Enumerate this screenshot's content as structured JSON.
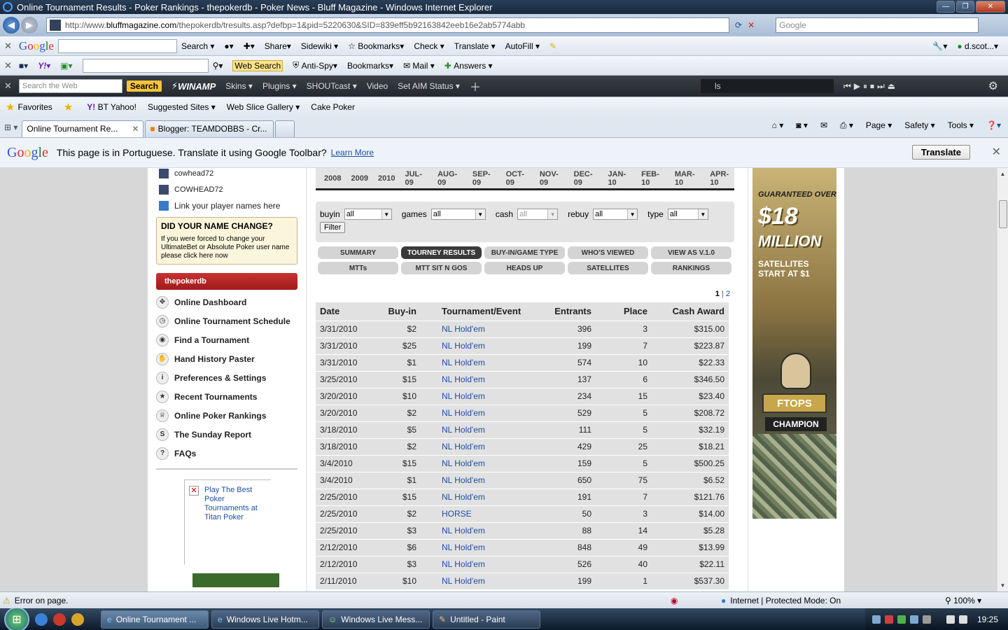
{
  "window": {
    "title": "Online Tournament Results - Poker Rankings - thepokerdb - Poker News - Bluff Magazine - Windows Internet Explorer"
  },
  "address": {
    "prefix": "http://www.",
    "domain": "bluffmagazine.com",
    "path": "/thepokerdb/tresults.asp?defbp=1&pid=5220630&SID=839eff5b92163842eeb16e2ab5774abb",
    "search_placeholder": "Google"
  },
  "google_toolbar": {
    "search": "Search",
    "share": "Share",
    "sidewiki": "Sidewiki",
    "bookmarks": "Bookmarks",
    "check": "Check",
    "translate": "Translate",
    "autofill": "AutoFill",
    "account": "d.scot..."
  },
  "yahoo_toolbar": {
    "web_search": "Web Search",
    "anti_spy": "Anti-Spy",
    "bookmarks": "Bookmarks",
    "mail": "Mail",
    "answers": "Answers"
  },
  "winamp_toolbar": {
    "placeholder": "Search the Web",
    "search": "Search",
    "brand": "WINAMP",
    "skins": "Skins",
    "plugins": "Plugins",
    "shoutcast": "SHOUTcast",
    "video": "Video",
    "aim": "Set AIM Status",
    "player_text": "ls"
  },
  "favorites": {
    "favorites": "Favorites",
    "bt_yahoo": "BT Yahoo!",
    "suggested": "Suggested Sites",
    "web_slice": "Web Slice Gallery",
    "cake": "Cake Poker"
  },
  "tabs": [
    {
      "label": "Online Tournament Re..."
    },
    {
      "label": "Blogger: TEAMDOBBS - Cr..."
    }
  ],
  "commands": {
    "page": "Page",
    "safety": "Safety",
    "tools": "Tools"
  },
  "translate_bar": {
    "logo": "Google",
    "message": "This page is in Portuguese.  Translate it using Google Toolbar?",
    "learn_more": "Learn More",
    "button": "Translate"
  },
  "sidebar": {
    "players": [
      "cowhead72",
      "COWHEAD72",
      "Link your player names here"
    ],
    "name_change": {
      "heading": "DID YOUR NAME CHANGE?",
      "text": "If you were forced to change your UltimateBet or Absolute Poker user name please click here now"
    },
    "header": "thepokerdb",
    "menu": [
      {
        "label": "Online Dashboard",
        "icon": "✥"
      },
      {
        "label": "Online Tournament Schedule",
        "icon": "◷"
      },
      {
        "label": "Find a Tournament",
        "icon": "◉"
      },
      {
        "label": "Hand History Paster",
        "icon": "✋"
      },
      {
        "label": "Preferences & Settings",
        "icon": "i"
      },
      {
        "label": "Recent Tournaments",
        "icon": "★"
      },
      {
        "label": "Online Poker Rankings",
        "icon": "♕"
      },
      {
        "label": "The Sunday Report",
        "icon": "S"
      },
      {
        "label": "FAQs",
        "icon": "?"
      }
    ],
    "ad_text": "Play The Best Poker Tournaments at Titan Poker"
  },
  "dates": [
    "2008",
    "2009",
    "2010",
    "JUL-09",
    "AUG-09",
    "SEP-09",
    "OCT-09",
    "NOV-09",
    "DEC-09",
    "JAN-10",
    "FEB-10",
    "MAR-10",
    "APR-10"
  ],
  "filters": {
    "buyin": {
      "label": "buyin",
      "value": "all"
    },
    "games": {
      "label": "games",
      "value": "all"
    },
    "cash": {
      "label": "cash",
      "value": "all"
    },
    "rebuy": {
      "label": "rebuy",
      "value": "all"
    },
    "type": {
      "label": "type",
      "value": "all"
    },
    "button": "Filter"
  },
  "view_tabs": [
    "SUMMARY",
    "TOURNEY RESULTS",
    "BUY-IN/GAME TYPE",
    "WHO'S VIEWED",
    "VIEW AS V.1.0",
    "MTTs",
    "MTT SIT N GOS",
    "HEADS UP",
    "SATELLITES",
    "RANKINGS"
  ],
  "pager": {
    "current": "1",
    "sep": "|",
    "next": "2"
  },
  "table": {
    "headers": [
      "Date",
      "Buy-in",
      "Tournament/Event",
      "Entrants",
      "Place",
      "Cash Award"
    ],
    "rows": [
      [
        "3/31/2010",
        "$2",
        "NL Hold'em",
        "396",
        "3",
        "$315.00"
      ],
      [
        "3/31/2010",
        "$25",
        "NL Hold'em",
        "199",
        "7",
        "$223.87"
      ],
      [
        "3/31/2010",
        "$1",
        "NL Hold'em",
        "574",
        "10",
        "$22.33"
      ],
      [
        "3/25/2010",
        "$15",
        "NL Hold'em",
        "137",
        "6",
        "$346.50"
      ],
      [
        "3/20/2010",
        "$10",
        "NL Hold'em",
        "234",
        "15",
        "$23.40"
      ],
      [
        "3/20/2010",
        "$2",
        "NL Hold'em",
        "529",
        "5",
        "$208.72"
      ],
      [
        "3/18/2010",
        "$5",
        "NL Hold'em",
        "111",
        "5",
        "$32.19"
      ],
      [
        "3/18/2010",
        "$2",
        "NL Hold'em",
        "429",
        "25",
        "$18.21"
      ],
      [
        "3/4/2010",
        "$15",
        "NL Hold'em",
        "159",
        "5",
        "$500.25"
      ],
      [
        "3/4/2010",
        "$1",
        "NL Hold'em",
        "650",
        "75",
        "$6.52"
      ],
      [
        "2/25/2010",
        "$15",
        "NL Hold'em",
        "191",
        "7",
        "$121.76"
      ],
      [
        "2/25/2010",
        "$2",
        "HORSE",
        "50",
        "3",
        "$14.00"
      ],
      [
        "2/25/2010",
        "$3",
        "NL Hold'em",
        "88",
        "14",
        "$5.28"
      ],
      [
        "2/12/2010",
        "$6",
        "NL Hold'em",
        "848",
        "49",
        "$13.99"
      ],
      [
        "2/12/2010",
        "$3",
        "NL Hold'em",
        "526",
        "40",
        "$22.11"
      ],
      [
        "2/11/2010",
        "$10",
        "NL Hold'em",
        "199",
        "1",
        "$537.30"
      ]
    ]
  },
  "ad": {
    "line1": "GUARANTEED OVER",
    "amount": "$18",
    "million": "MILLION",
    "line3": "SATELLITES START AT $1",
    "ftops": "FTOPS",
    "champion": "CHAMPION"
  },
  "status": {
    "error": "Error on page.",
    "zone": "Internet | Protected Mode: On",
    "zoom": "100%"
  },
  "taskbar": {
    "buttons": [
      "Online Tournament ...",
      "Windows Live Hotm...",
      "Windows Live Mess...",
      "Untitled - Paint"
    ],
    "clock": "19:25"
  }
}
